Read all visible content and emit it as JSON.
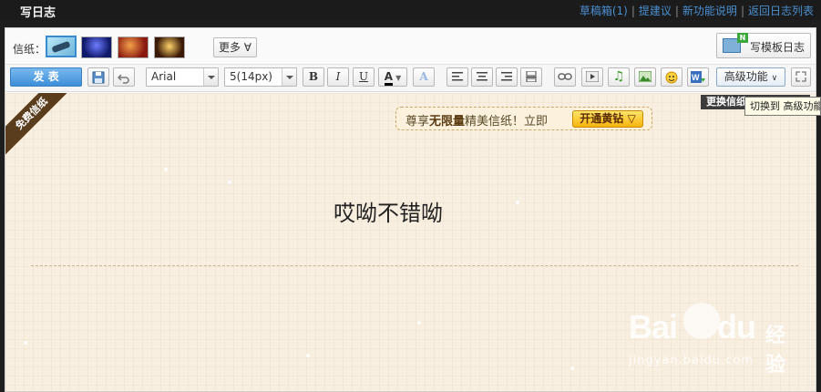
{
  "topbar": {
    "title": "写日志",
    "links": [
      "草稿箱(1)",
      "提建议",
      "新功能说明",
      "返回日志列表"
    ],
    "separator": "|"
  },
  "toolbar_top": {
    "stationery_label": "信纸：",
    "more_label": "更多 ∀",
    "template_label": "写模板日志"
  },
  "toolbar_format": {
    "publish_label": "发 表",
    "font_value": "Arial",
    "size_value": "5(14px)",
    "bold": "B",
    "italic": "I",
    "underline": "U",
    "font_color": "A",
    "advanced_label": "高级功能"
  },
  "editor": {
    "ribbon_text": "免费信纸",
    "promo_text_a": "尊享",
    "promo_text_b": "无限量",
    "promo_text_c": "精美信纸！立即",
    "promo_button": "开通黄钻",
    "content_text": "哎呦不错呦"
  },
  "tooltips": {
    "change_stationery": "更换信纸",
    "switch_advanced": "切换到 高级功能"
  },
  "watermark": {
    "brand": "Bai",
    "brand2": "du",
    "cn": "经验",
    "url": "jingyan.baidu.com"
  }
}
